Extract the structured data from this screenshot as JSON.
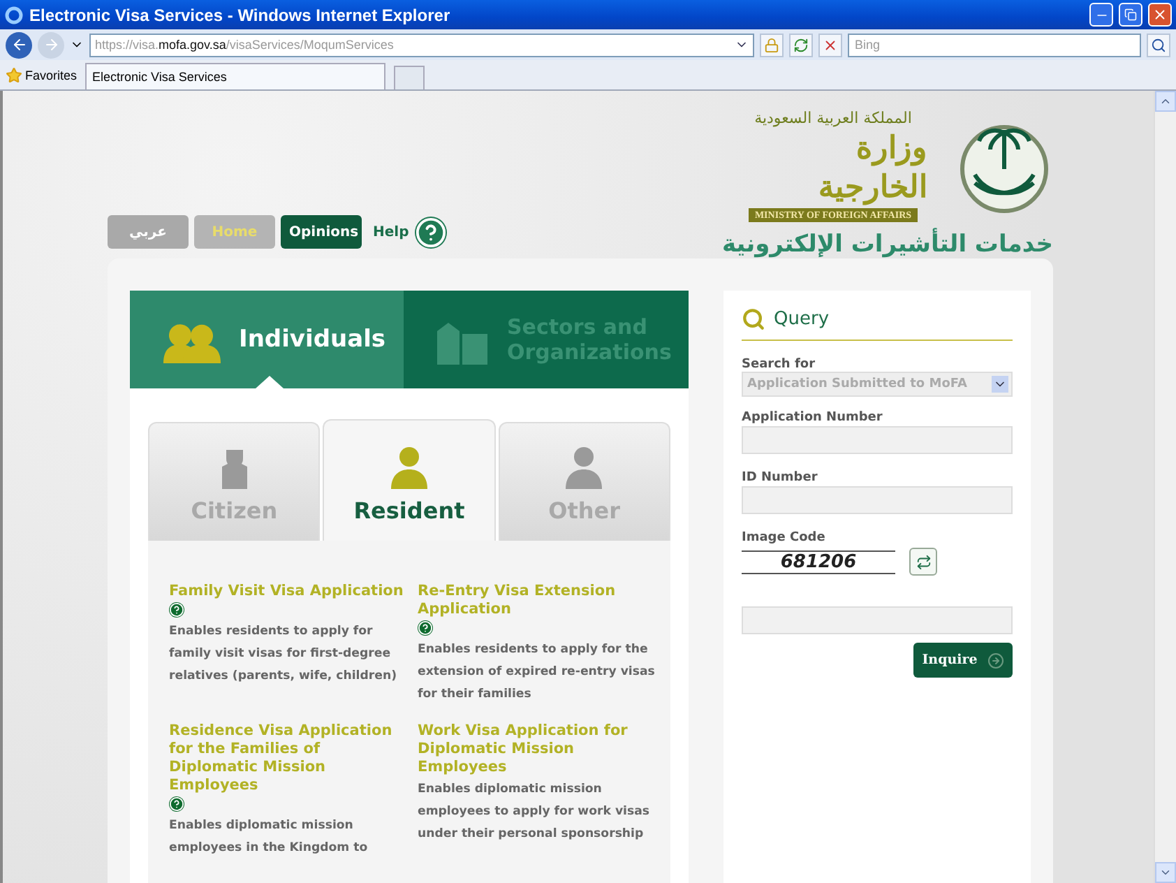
{
  "window": {
    "title": "Electronic Visa Services - Windows Internet Explorer"
  },
  "address_bar": {
    "scheme": "https://visa.",
    "domain": "mofa.gov.sa",
    "path": "/visaServices/MoqumServices"
  },
  "search": {
    "placeholder": "Bing"
  },
  "favorites": {
    "label": "Favorites"
  },
  "browser_tab": {
    "label": "Electronic Visa Services"
  },
  "header": {
    "kingdom": "المملكة العربية السعودية",
    "ministry_ar": "وزارة الخارجية",
    "ministry_en": "MINISTRY OF FOREIGN AFFAIRS",
    "service_title": "خدمات التأشيرات الإلكترونية"
  },
  "nav": [
    {
      "label": "عربي",
      "kind": "plain"
    },
    {
      "label": "Home",
      "kind": "home"
    },
    {
      "label": "Opinions",
      "kind": "primary"
    }
  ],
  "help": {
    "label": "Help"
  },
  "categories": [
    {
      "label": "Individuals",
      "selected": true,
      "kind": "people"
    },
    {
      "label": "Sectors and Organizations",
      "selected": false,
      "kind": "buildings"
    }
  ],
  "subtabs": [
    {
      "label": "Citizen",
      "selected": false,
      "kind": "citizen"
    },
    {
      "label": "Resident",
      "selected": true,
      "kind": "resident"
    },
    {
      "label": "Other",
      "selected": false,
      "kind": "other"
    }
  ],
  "services": [
    {
      "title": "Family Visit Visa Application",
      "help": true,
      "description": "Enables residents to apply for family visit visas for first-degree relatives (parents, wife, children)"
    },
    {
      "title": "Re-Entry Visa Extension Application",
      "help": true,
      "description": "Enables residents to apply for the extension of expired re-entry visas for their families"
    },
    {
      "title": "Residence Visa Application for the Families of Diplomatic Mission Employees",
      "help": true,
      "description": "Enables diplomatic mission employees in the Kingdom to"
    },
    {
      "title": "Work Visa Application for Diplomatic Mission Employees",
      "help": false,
      "description": "Enables diplomatic mission employees to apply for work visas under their personal sponsorship"
    }
  ],
  "query": {
    "title": "Query",
    "fields": [
      {
        "kind": "select",
        "label": "Search for",
        "value": "Application Submitted to MoFA"
      },
      {
        "kind": "text",
        "label": "Application Number"
      },
      {
        "kind": "text",
        "label": "ID Number"
      },
      {
        "kind": "captcha",
        "label": "Image Code",
        "code": "681206"
      },
      {
        "kind": "text"
      }
    ],
    "button": "Inquire"
  }
}
